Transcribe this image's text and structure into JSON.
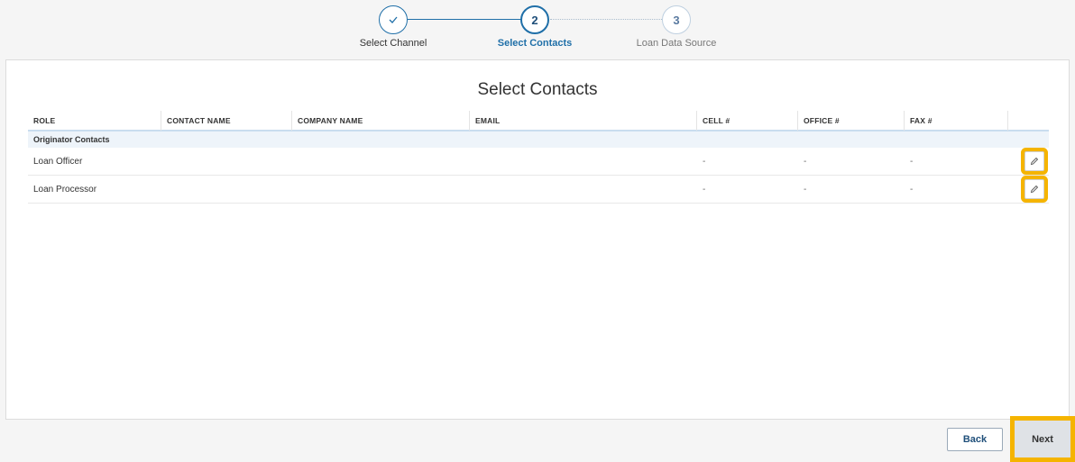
{
  "stepper": {
    "steps": [
      {
        "number": "",
        "label": "Select Channel",
        "state": "completed"
      },
      {
        "number": "2",
        "label": "Select Contacts",
        "state": "active"
      },
      {
        "number": "3",
        "label": "Loan Data Source",
        "state": "upcoming"
      }
    ]
  },
  "panel": {
    "title": "Select Contacts"
  },
  "table": {
    "columns": [
      "ROLE",
      "CONTACT NAME",
      "COMPANY NAME",
      "EMAIL",
      "CELL #",
      "OFFICE #",
      "FAX #"
    ],
    "group": "Originator Contacts",
    "rows": [
      {
        "role": "Loan Officer",
        "contact_name": "",
        "company_name": "",
        "email": "",
        "cell": "-",
        "office": "-",
        "fax": "-"
      },
      {
        "role": "Loan Processor",
        "contact_name": "",
        "company_name": "",
        "email": "",
        "cell": "-",
        "office": "-",
        "fax": "-"
      }
    ]
  },
  "footer": {
    "back_label": "Back",
    "next_label": "Next"
  },
  "colors": {
    "accent": "#1f6fa8",
    "highlight": "#f5b400"
  },
  "icons": {
    "step_completed": "check-icon",
    "edit": "pencil-icon"
  }
}
